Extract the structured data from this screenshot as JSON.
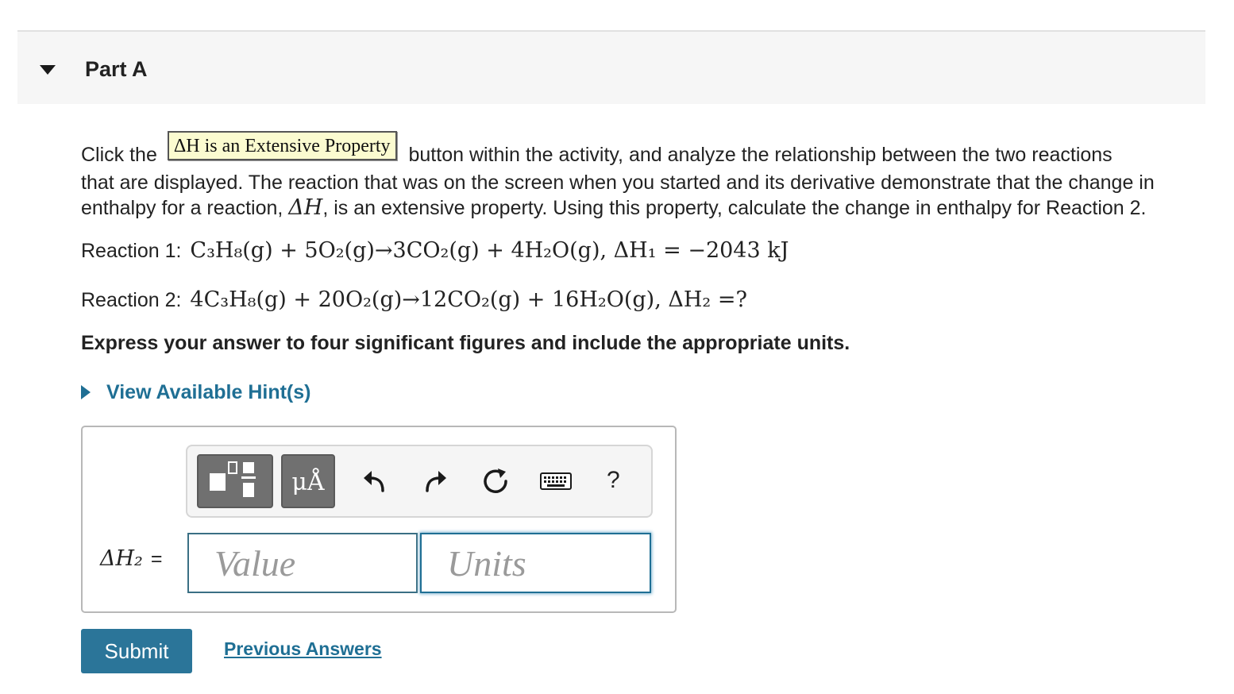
{
  "part": {
    "title": "Part A"
  },
  "prompt": {
    "intro": "Click the",
    "activity_button": "ΔH is an Extensive Property",
    "after_button": "button within the activity, and analyze the relationship between the two reactions",
    "line2": "that are displayed. The reaction that was on the screen when you started and its derivative demonstrate that the change in",
    "line3_start": "enthalpy for a reaction,",
    "line3_math": "ΔH",
    "line3_end": ", is an extensive property. Using this property, calculate the change in enthalpy for Reaction 2."
  },
  "reactions": [
    {
      "label": "Reaction 1:",
      "equation": "C₃H₈(g) + 5O₂(g)→3CO₂(g) + 4H₂O(g), ΔH₁ = −2043 kJ"
    },
    {
      "label": "Reaction 2:",
      "equation": "4C₃H₈(g) + 20O₂(g)→12CO₂(g) + 16H₂O(g), ΔH₂ =?"
    }
  ],
  "instruction": "Express your answer to four significant figures and include the appropriate units.",
  "hint_link": "View Available Hint(s)",
  "toolbar": {
    "units_button": "μÅ",
    "help": "?"
  },
  "answer": {
    "label": "ΔH₂",
    "equals": "=",
    "value_placeholder": "Value",
    "units_placeholder": "Units",
    "value": "",
    "units": ""
  },
  "actions": {
    "submit_label": "Submit",
    "previous_answers_label": "Previous Answers"
  },
  "colors": {
    "accent": "#2b7599",
    "link": "#1f6f94",
    "header_bg": "#f6f6f6",
    "activity_button_bg": "#fbfbd0"
  },
  "icons": [
    "collapse-triangle-icon",
    "templates-icon",
    "undo-icon",
    "redo-icon",
    "reset-icon",
    "keyboard-icon",
    "help-icon",
    "hint-arrow-icon"
  ]
}
